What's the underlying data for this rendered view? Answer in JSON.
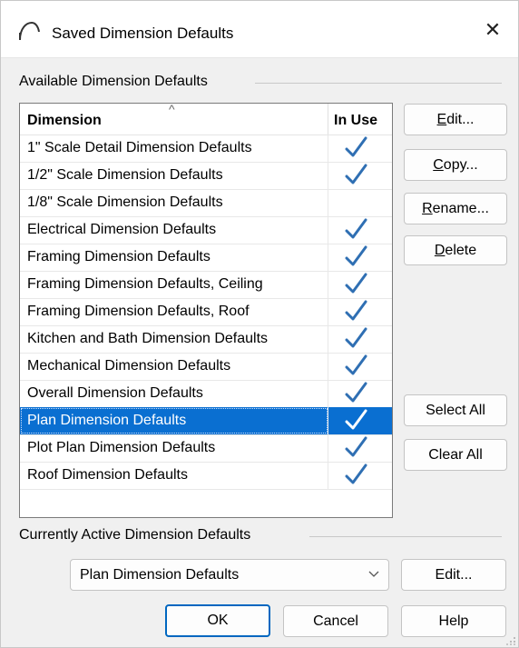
{
  "window": {
    "title": "Saved Dimension Defaults",
    "close_glyph": "✕",
    "icon": "arc-icon"
  },
  "available": {
    "label": "Available Dimension Defaults",
    "columns": {
      "dimension": "Dimension",
      "in_use": "In Use",
      "sort_glyph": "^"
    },
    "rows": [
      {
        "name": "1\" Scale Detail Dimension Defaults",
        "in_use": true
      },
      {
        "name": "1/2\" Scale Dimension Defaults",
        "in_use": true
      },
      {
        "name": "1/8\" Scale Dimension Defaults",
        "in_use": false
      },
      {
        "name": "Electrical Dimension Defaults",
        "in_use": true
      },
      {
        "name": "Framing Dimension Defaults",
        "in_use": true
      },
      {
        "name": "Framing Dimension Defaults, Ceiling",
        "in_use": true
      },
      {
        "name": "Framing Dimension Defaults, Roof",
        "in_use": true
      },
      {
        "name": "Kitchen and Bath Dimension Defaults",
        "in_use": true
      },
      {
        "name": "Mechanical Dimension Defaults",
        "in_use": true
      },
      {
        "name": "Overall Dimension Defaults",
        "in_use": true
      },
      {
        "name": "Plan Dimension Defaults",
        "in_use": true,
        "selected": true
      },
      {
        "name": "Plot Plan Dimension Defaults",
        "in_use": true
      },
      {
        "name": "Roof Dimension Defaults",
        "in_use": true
      }
    ]
  },
  "side_buttons": {
    "edit": {
      "accel": "E",
      "rest": "dit..."
    },
    "copy": {
      "accel": "C",
      "rest": "opy..."
    },
    "rename": {
      "accel": "R",
      "rest": "ename..."
    },
    "delete": {
      "accel": "D",
      "rest": "elete"
    },
    "select_all": "Select All",
    "clear_all": "Clear All"
  },
  "active": {
    "label": "Currently Active Dimension Defaults",
    "selected": "Plan Dimension Defaults",
    "edit_button": "Edit..."
  },
  "footer": {
    "ok": "OK",
    "cancel": "Cancel",
    "help": "Help"
  },
  "colors": {
    "selection": "#0a6fd1",
    "check": "#2f6fb3",
    "primary_border": "#0067c0"
  }
}
